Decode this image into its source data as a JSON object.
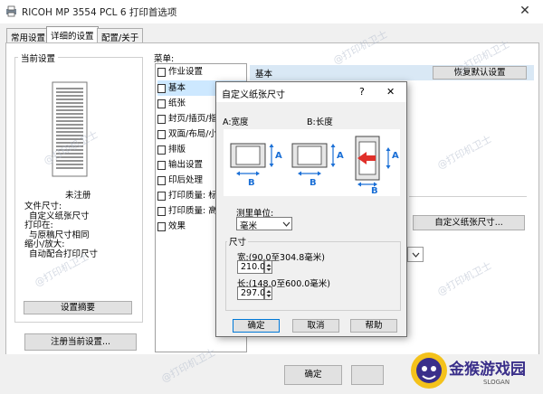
{
  "window": {
    "title": "RICOH MP 3554 PCL 6 打印首选项",
    "close_glyph": "✕"
  },
  "tabs": [
    {
      "label": "常用设置"
    },
    {
      "label": "详细的设置"
    },
    {
      "label": "配置/关于"
    }
  ],
  "left_panel": {
    "group_title": "当前设置",
    "user_label": "未注册",
    "summary_lines": [
      "文件尺寸:",
      "自定义纸张尺寸",
      "打印在:",
      "与原稿尺寸相同",
      "缩小/放大:",
      "自动配合打印尺寸"
    ],
    "settings_summary_button": "设置摘要",
    "register_button": "注册当前设置..."
  },
  "menu": {
    "label": "菜单:",
    "items": [
      {
        "label": "作业设置"
      },
      {
        "label": "基本"
      },
      {
        "label": "纸张"
      },
      {
        "label": "封页/插页/指"
      },
      {
        "label": "双面/布局/小"
      },
      {
        "label": "排版"
      },
      {
        "label": "输出设置"
      },
      {
        "label": "印后处理"
      },
      {
        "label": "打印质量: 标"
      },
      {
        "label": "打印质量: 高"
      },
      {
        "label": "效果"
      }
    ]
  },
  "right_panel": {
    "header": "基本",
    "restore_defaults_button": "恢复默认设置",
    "custom_paper_button": "自定义纸张尺寸..."
  },
  "footer": {
    "ok_button": "确定"
  },
  "dialog": {
    "title": "自定义纸张尺寸",
    "help_glyph": "?",
    "close_glyph": "✕",
    "label_a": "A:宽度",
    "label_b": "B:长度",
    "diagram_a": "A",
    "diagram_b": "B",
    "unit_label": "测里单位:",
    "unit_value": "毫米",
    "size_group_title": "尺寸",
    "width_label": "宽:(90.0至304.8毫米)",
    "width_value": "210.0",
    "length_label": "长:(148.0至600.0毫米)",
    "length_value": "297.0",
    "ok_button": "确定",
    "cancel_button": "取消",
    "help_button": "帮助"
  },
  "watermark": {
    "text": "@打印机卫士"
  },
  "brand_logo": {
    "text": "金猴游戏园",
    "subtext": "SLOGAN"
  },
  "colors": {
    "accent": "#0078d7",
    "header_bg": "#d9e8f5",
    "arrow_blue": "#1a6fd6",
    "arrow_red": "#e0302a"
  }
}
